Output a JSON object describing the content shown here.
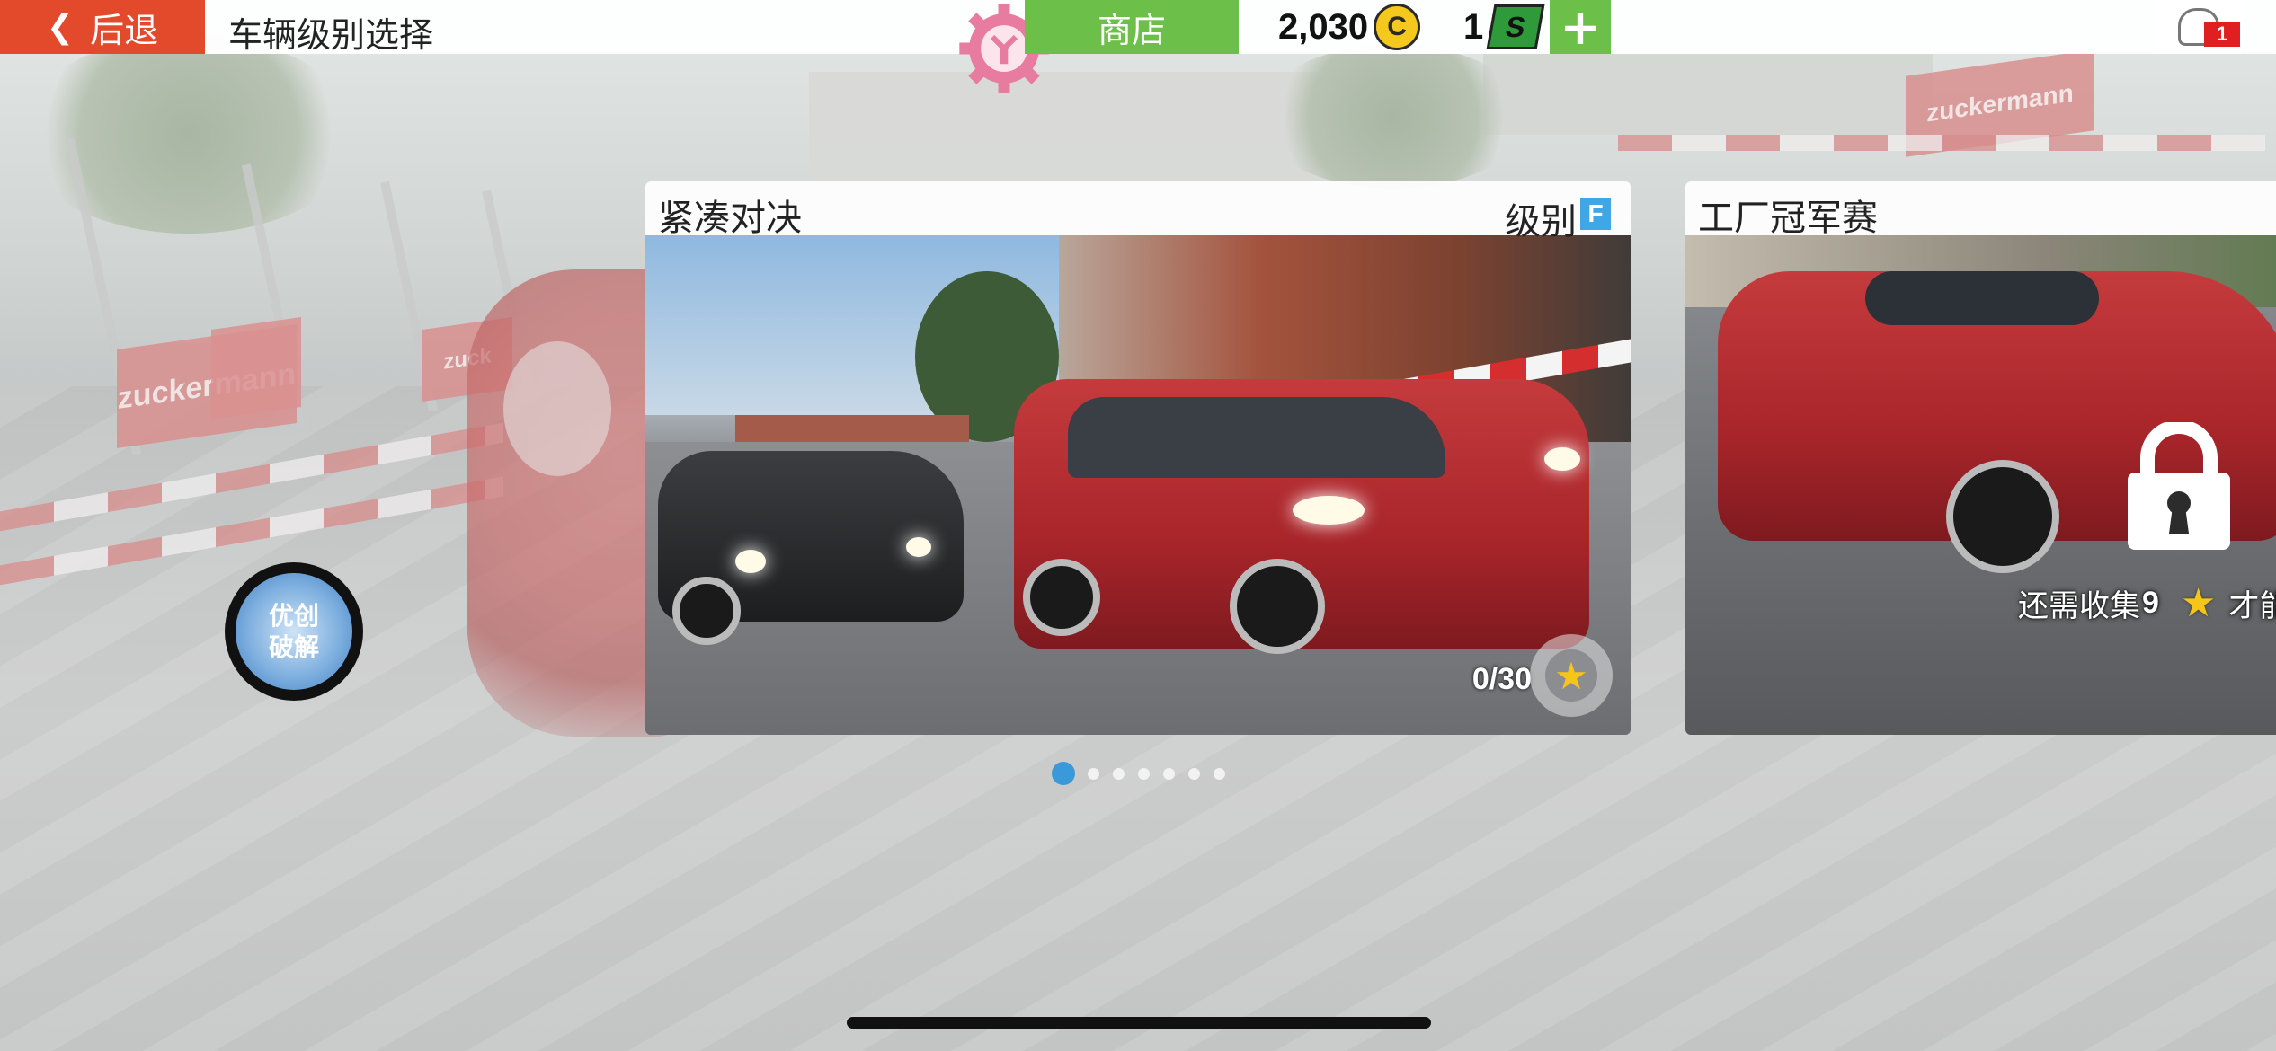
{
  "topbar": {
    "back_label": "后退",
    "title": "车辆级别选择",
    "gear_icon": "settings-gear-icon",
    "shop_label": "商店",
    "coins": "2,030",
    "coin_symbol": "C",
    "super_coins": "1",
    "super_symbol": "S",
    "plus_label": "+",
    "notification_count": "1"
  },
  "watermark": {
    "line1": "优创",
    "line2": "破解"
  },
  "cards": [
    {
      "title": "紧凑对决",
      "class_label": "级别",
      "class_value": "F",
      "progress": "0/30",
      "locked": false
    },
    {
      "title": "工厂冠军赛",
      "locked": true,
      "lock_text_prefix": "还需收集",
      "lock_text_count": "9",
      "lock_text_suffix": "才能"
    }
  ],
  "pager": {
    "total": 7,
    "active_index": 0
  },
  "colors": {
    "back": "#e34a2c",
    "shop": "#6cc04a",
    "accent": "#3a9ad9",
    "star": "#f5c518"
  }
}
